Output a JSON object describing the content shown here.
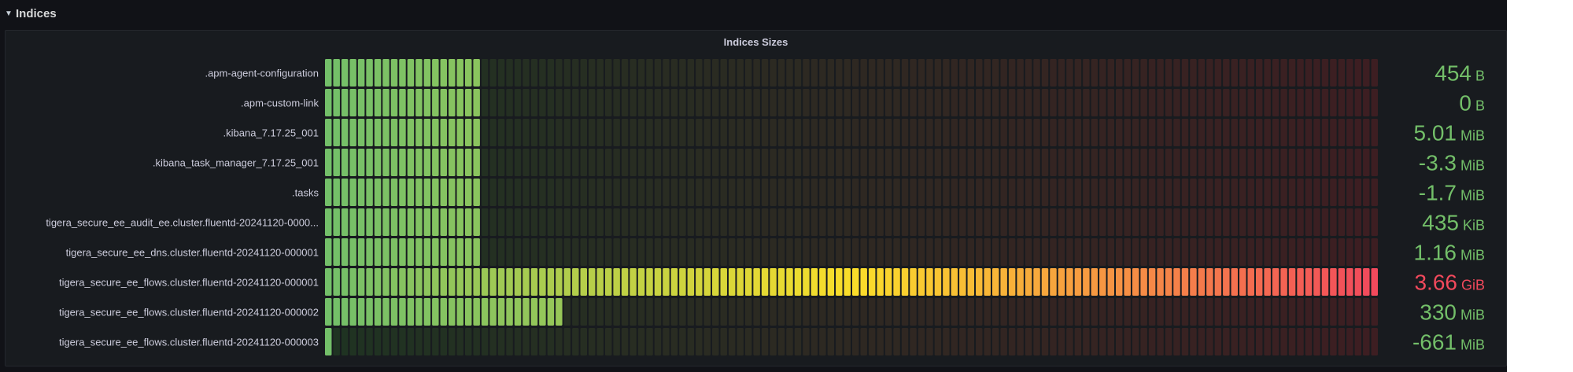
{
  "row": {
    "title": "Indices",
    "chevron": "chevron-down-icon"
  },
  "panel": {
    "title": "Indices Sizes"
  },
  "colors": {
    "low": "#73bf69",
    "mid": "#fade2a",
    "high": "#f2495c",
    "value_green": "#73bf69",
    "value_red": "#f2495c",
    "empty_low": "#1f3322",
    "empty_high": "#3d1e22"
  },
  "gauge": {
    "segments": 128,
    "items": [
      {
        "label": ".apm-agent-configuration",
        "value": "454",
        "unit": "B",
        "fill": 0.152,
        "color": "green"
      },
      {
        "label": ".apm-custom-link",
        "value": "0",
        "unit": "B",
        "fill": 0.152,
        "color": "green"
      },
      {
        "label": ".kibana_7.17.25_001",
        "value": "5.01",
        "unit": "MiB",
        "fill": 0.152,
        "color": "green"
      },
      {
        "label": ".kibana_task_manager_7.17.25_001",
        "value": "-3.3",
        "unit": "MiB",
        "fill": 0.152,
        "color": "green"
      },
      {
        "label": ".tasks",
        "value": "-1.7",
        "unit": "MiB",
        "fill": 0.152,
        "color": "green"
      },
      {
        "label": "tigera_secure_ee_audit_ee.cluster.fluentd-20241120-0000...",
        "value": "435",
        "unit": "KiB",
        "fill": 0.152,
        "color": "green"
      },
      {
        "label": "tigera_secure_ee_dns.cluster.fluentd-20241120-000001",
        "value": "1.16",
        "unit": "MiB",
        "fill": 0.152,
        "color": "green"
      },
      {
        "label": "tigera_secure_ee_flows.cluster.fluentd-20241120-000001",
        "value": "3.66",
        "unit": "GiB",
        "fill": 1.0,
        "color": "red"
      },
      {
        "label": "tigera_secure_ee_flows.cluster.fluentd-20241120-000002",
        "value": "330",
        "unit": "MiB",
        "fill": 0.228,
        "color": "green"
      },
      {
        "label": "tigera_secure_ee_flows.cluster.fluentd-20241120-000003",
        "value": "-661",
        "unit": "MiB",
        "fill": 0.008,
        "color": "green"
      }
    ]
  }
}
